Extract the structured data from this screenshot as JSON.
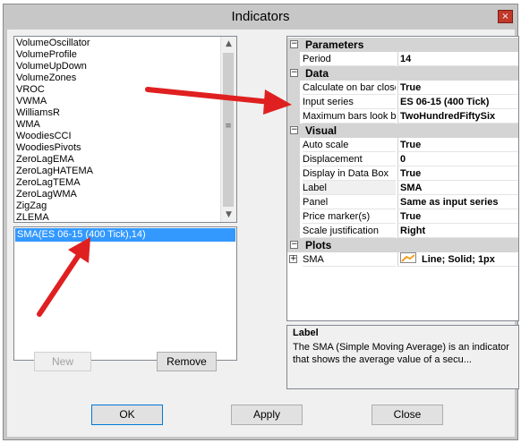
{
  "window": {
    "title": "Indicators",
    "close_glyph": "×"
  },
  "indicator_list": {
    "items": [
      "VolumeOscillator",
      "VolumeProfile",
      "VolumeUpDown",
      "VolumeZones",
      "VROC",
      "VWMA",
      "WilliamsR",
      "WMA",
      "WoodiesCCI",
      "WoodiesPivots",
      "ZeroLagEMA",
      "ZeroLagHATEMA",
      "ZeroLagTEMA",
      "ZeroLagWMA",
      "ZigZag",
      "ZLEMA"
    ],
    "scroll_up_glyph": "▲",
    "scroll_down_glyph": "▼",
    "grip_glyph": "≡"
  },
  "applied": {
    "items": [
      "SMA(ES 06-15 (400 Tick),14)"
    ]
  },
  "list_buttons": {
    "new_label": "New",
    "remove_label": "Remove"
  },
  "properties": {
    "categories": {
      "parameters": "Parameters",
      "data": "Data",
      "visual": "Visual",
      "plots": "Plots"
    },
    "collapse_glyph": "−",
    "expand_glyph": "+",
    "rows": {
      "period": {
        "name": "Period",
        "value": "14"
      },
      "calculate": {
        "name": "Calculate on bar close",
        "value": "True"
      },
      "input_series": {
        "name": "Input series",
        "value": "ES 06-15 (400 Tick)"
      },
      "max_bars": {
        "name": "Maximum bars look back",
        "value": "TwoHundredFiftySix"
      },
      "auto_scale": {
        "name": "Auto scale",
        "value": "True"
      },
      "displacement": {
        "name": "Displacement",
        "value": "0"
      },
      "display_data_box": {
        "name": "Display in Data Box",
        "value": "True"
      },
      "label": {
        "name": "Label",
        "value": "SMA"
      },
      "panel": {
        "name": "Panel",
        "value": "Same as input series"
      },
      "price_marker": {
        "name": "Price marker(s)",
        "value": "True"
      },
      "scale_justification": {
        "name": "Scale justification",
        "value": "Right"
      },
      "plot_sma": {
        "name": "SMA",
        "value": "Line; Solid; 1px"
      }
    },
    "plot_color": "#f0a020"
  },
  "description": {
    "title": "Label",
    "text": "The SMA (Simple Moving Average) is an indicator that shows the average value of a secu..."
  },
  "footer": {
    "ok_label": "OK",
    "apply_label": "Apply",
    "close_label": "Close"
  },
  "colors": {
    "arrow": "#e02020",
    "selection": "#3399ff",
    "close_button": "#c0392b"
  }
}
